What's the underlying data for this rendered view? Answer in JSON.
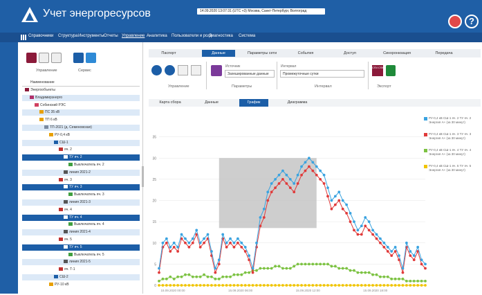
{
  "app": {
    "title": "Учет энергоресурсов",
    "datetime_bar": "14.09.2020 13:07:31 (UTC +3) Москва, Санкт-Петербург, Волгоград"
  },
  "menu": {
    "items": [
      {
        "label": "Справочники"
      },
      {
        "label": "Структура"
      },
      {
        "label": "Инструменты"
      },
      {
        "label": "Отчеты"
      },
      {
        "label": "Управление",
        "active": true
      },
      {
        "label": "Аналитика"
      },
      {
        "label": "Пользователи и роли"
      },
      {
        "label": "Диагностика"
      },
      {
        "label": "Система"
      }
    ]
  },
  "left_toolbar": {
    "group1": "Управление",
    "group2": "Сервис"
  },
  "tree": {
    "header": "Наименование",
    "rows": [
      {
        "label": "Энергообъекты",
        "indent": 0,
        "state": "normal",
        "icon": "folder-icon",
        "color": "#8b1a3a"
      },
      {
        "label": "Владимирэнерго",
        "indent": 1,
        "state": "alt",
        "icon": "building-icon",
        "color": "#b0306a"
      },
      {
        "label": "Собинский РЭС",
        "indent": 2,
        "state": "normal",
        "icon": "building-icon",
        "color": "#d04060"
      },
      {
        "label": "ПС 35 кВ",
        "indent": 3,
        "state": "alt",
        "icon": "warning-icon",
        "color": "#e8a000"
      },
      {
        "label": "ТП 6 кВ",
        "indent": 3,
        "state": "normal",
        "icon": "warning-icon",
        "color": "#e8a000"
      },
      {
        "label": "ТП-2021 (д. Семеновская)",
        "indent": 4,
        "state": "alt",
        "icon": "building-icon",
        "color": "#7a8aa0"
      },
      {
        "label": "РУ-0,4 кВ",
        "indent": 5,
        "state": "normal",
        "icon": "warning-icon",
        "color": "#e8a000"
      },
      {
        "label": "СШ-1",
        "indent": 6,
        "state": "alt",
        "icon": "bus-icon",
        "color": "#1c5ea7"
      },
      {
        "label": "яч. 2",
        "indent": 7,
        "state": "normal",
        "icon": "cell-icon",
        "color": "#c03030"
      },
      {
        "label": "ТУ яч. 2",
        "indent": 8,
        "state": "selected",
        "icon": "meter-icon",
        "color": "#ffffff"
      },
      {
        "label": "Выключатель яч. 2",
        "indent": 9,
        "state": "normal",
        "icon": "switch-icon",
        "color": "#40a040"
      },
      {
        "label": "линия 2021-2",
        "indent": 8,
        "state": "alt",
        "icon": "line-icon",
        "color": "#555555"
      },
      {
        "label": "яч. 3",
        "indent": 7,
        "state": "normal",
        "icon": "cell-icon",
        "color": "#c03030"
      },
      {
        "label": "ТУ яч. 3",
        "indent": 8,
        "state": "selected",
        "icon": "meter-icon",
        "color": "#ffffff"
      },
      {
        "label": "Выключатель яч. 3",
        "indent": 9,
        "state": "normal",
        "icon": "switch-icon",
        "color": "#40a040"
      },
      {
        "label": "линия 2021-3",
        "indent": 8,
        "state": "alt",
        "icon": "line-icon",
        "color": "#555555"
      },
      {
        "label": "яч. 4",
        "indent": 7,
        "state": "normal",
        "icon": "cell-icon",
        "color": "#c03030"
      },
      {
        "label": "ТУ яч. 4",
        "indent": 8,
        "state": "selected",
        "icon": "meter-icon",
        "color": "#ffffff"
      },
      {
        "label": "Выключатель яч. 4",
        "indent": 9,
        "state": "normal",
        "icon": "switch-icon",
        "color": "#40a040"
      },
      {
        "label": "линия 2021-4",
        "indent": 8,
        "state": "alt",
        "icon": "line-icon",
        "color": "#555555"
      },
      {
        "label": "яч. 5",
        "indent": 7,
        "state": "normal",
        "icon": "cell-icon",
        "color": "#c03030"
      },
      {
        "label": "ТУ яч. 5",
        "indent": 8,
        "state": "selected",
        "icon": "meter-icon",
        "color": "#ffffff"
      },
      {
        "label": "Выключатель яч. 5",
        "indent": 9,
        "state": "normal",
        "icon": "switch-icon",
        "color": "#40a040"
      },
      {
        "label": "линия 2021-5",
        "indent": 8,
        "state": "alt",
        "icon": "line-icon",
        "color": "#555555"
      },
      {
        "label": "яч. Т-1",
        "indent": 7,
        "state": "normal",
        "icon": "cell-icon",
        "color": "#c03030"
      },
      {
        "label": "СШ-2",
        "indent": 6,
        "state": "alt",
        "icon": "bus-icon",
        "color": "#1c5ea7"
      },
      {
        "label": "РУ-10 кВ",
        "indent": 5,
        "state": "normal",
        "icon": "warning-icon",
        "color": "#e8a000"
      }
    ]
  },
  "tabs": [
    {
      "label": "Паспорт"
    },
    {
      "label": "Данные",
      "active": true
    },
    {
      "label": "Параметры сети"
    },
    {
      "label": "События"
    },
    {
      "label": "Доступ"
    },
    {
      "label": "Синхронизация"
    },
    {
      "label": "Передача"
    }
  ],
  "toolbar": {
    "group_control": "Управление",
    "group_params": "Параметры",
    "group_interval": "Интервал",
    "group_export": "Экспорт",
    "source_label": "Источник",
    "source_value": "Захешированные данные",
    "interval_label": "Интервал",
    "interval_value": "Промежуточные сутки",
    "export_csv": "CSV",
    "export_csv_sub": "CSV.CSM"
  },
  "subtabs": [
    {
      "label": "Карта сбора"
    },
    {
      "label": "Данные"
    },
    {
      "label": "График",
      "active": true
    },
    {
      "label": "Диаграмма"
    }
  ],
  "colors": {
    "series_blue": "#3aa3e0",
    "series_red": "#e03a3a",
    "series_green": "#7cc242",
    "series_yellow": "#f0c400",
    "header_blue": "#1f5fa6",
    "selection": "#1c5ea7"
  },
  "chart_data": {
    "type": "line",
    "ylim": [
      0,
      40
    ],
    "yticks": [
      "0",
      "5",
      "10",
      "15",
      "20",
      "25",
      "30",
      "35"
    ],
    "xticks": [
      "15.09.2020 00:00",
      "15.09.2020 06:00",
      "15.09.2020 12:00",
      "15.09.2020 18:00"
    ],
    "x_count": 72,
    "highlight_x": [
      16,
      42
    ],
    "series": [
      {
        "name": "РУ-0,4 кВ СШ-1 яч. 2 ТУ яч. 2",
        "sub": "Энергия А+ (за 30 минут)",
        "color": "#3aa3e0",
        "values": [
          4,
          10,
          11,
          9,
          10,
          9,
          12,
          11,
          10,
          11,
          13,
          10,
          11,
          12,
          8,
          4,
          6,
          12,
          10,
          11,
          10,
          11,
          10,
          9,
          7,
          4,
          10,
          16,
          18,
          22,
          24,
          25,
          26,
          27,
          26,
          25,
          24,
          26,
          28,
          29,
          30,
          29,
          28,
          27,
          26,
          23,
          20,
          21,
          22,
          20,
          19,
          17,
          15,
          13,
          14,
          16,
          15,
          13,
          12,
          11,
          10,
          9,
          8,
          9,
          7,
          4,
          10,
          8,
          7,
          9,
          6,
          5
        ]
      },
      {
        "name": "РУ-0,4 кВ СШ-1 яч. 3 ТУ яч. 3",
        "sub": "Энергия А+ (за 30 минут)",
        "color": "#e03a3a",
        "values": [
          3,
          9,
          10,
          8,
          9,
          8,
          11,
          10,
          9,
          10,
          12,
          9,
          10,
          11,
          7,
          3,
          5,
          11,
          9,
          10,
          9,
          10,
          9,
          8,
          6,
          3,
          9,
          14,
          16,
          20,
          22,
          23,
          24,
          25,
          24,
          23,
          22,
          24,
          26,
          27,
          28,
          27,
          26,
          25,
          24,
          21,
          18,
          19,
          20,
          18,
          17,
          15,
          13,
          12,
          12,
          14,
          13,
          12,
          11,
          10,
          9,
          8,
          7,
          8,
          6,
          3,
          9,
          7,
          6,
          8,
          5,
          4
        ]
      },
      {
        "name": "РУ-0,4 кВ СШ-1 яч. 4 ТУ яч. 4",
        "sub": "Энергия А+ (за 30 минут)",
        "color": "#7cc242",
        "values": [
          1,
          1.5,
          1.5,
          2,
          1.5,
          2,
          2,
          2.5,
          2.5,
          2,
          2,
          2,
          2.5,
          2,
          2,
          1.5,
          1.5,
          2,
          2,
          2,
          2.5,
          2.5,
          2.5,
          3,
          3,
          3.5,
          3.5,
          4,
          4,
          4,
          4,
          4.5,
          4.5,
          4,
          4,
          4,
          4.5,
          5,
          5,
          5,
          5,
          5,
          5,
          5,
          5,
          5,
          4.5,
          4.5,
          4,
          4,
          4,
          3.5,
          3.5,
          3,
          3,
          3,
          3,
          2.5,
          2.5,
          2,
          2,
          2,
          1.5,
          1.5,
          1.5,
          1.5,
          1,
          1,
          1,
          1,
          1,
          1
        ]
      },
      {
        "name": "РУ-0,4 кВ СШ-1 яч. 5 ТУ яч. 5",
        "sub": "Энергия А+ (за 30 минут)",
        "color": "#f0c400",
        "values": [
          0,
          0,
          0,
          0,
          0,
          0,
          0,
          0,
          0,
          0,
          0,
          0,
          0,
          0,
          0,
          0,
          0,
          0,
          0,
          0,
          0,
          0,
          0,
          0,
          0,
          0,
          0,
          0,
          0,
          0,
          0,
          0,
          0,
          0,
          0,
          0,
          0,
          0,
          0,
          0,
          0,
          0,
          0,
          0,
          0,
          0,
          0,
          0,
          0,
          0,
          0,
          0,
          0,
          0,
          0,
          0,
          0,
          0,
          0,
          0,
          0,
          0,
          0,
          0,
          0,
          0,
          0,
          0,
          0,
          0,
          0,
          0
        ]
      }
    ]
  }
}
